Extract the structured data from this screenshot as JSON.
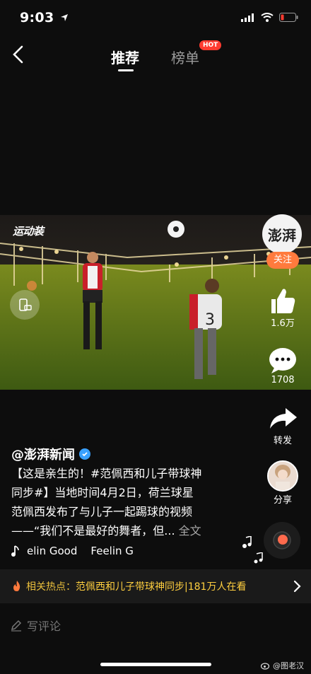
{
  "status": {
    "time": "9:03"
  },
  "nav": {
    "tabs": [
      "推荐",
      "榜单"
    ],
    "hot_badge": "HOT"
  },
  "video": {
    "watermark": "运动装"
  },
  "rail": {
    "avatar_text": "澎湃",
    "follow": "关注",
    "likes": "1.6万",
    "comments": "1708",
    "forward": "转发",
    "share": "分享"
  },
  "post": {
    "author": "@澎湃新闻",
    "caption_line1": "【这是亲生的！#范佩西和儿子带球神",
    "caption_line2": "同步#】当地时间4月2日，荷兰球星",
    "caption_line3": "范佩西发布了与儿子一起踢球的视频",
    "caption_line4": "——“我们不是最好的舞者，但...",
    "more": "全文",
    "music": "elin Good    Feelin G"
  },
  "hot_topic": {
    "label": "相关热点：",
    "text": "范佩西和儿子带球神同步|181万人在看"
  },
  "comment": {
    "placeholder": "写评论"
  },
  "weibo_watermark": "@图老汉",
  "colors": {
    "accent": "#ff7a3d",
    "hot": "#ffcf3f",
    "verified": "#3aa1ff",
    "hot_badge": "#ff3b30"
  },
  "icons": [
    "location-arrow-icon",
    "signal-icon",
    "wifi-icon",
    "battery-icon",
    "back-chevron-icon",
    "rotate-screen-icon",
    "thumb-up-icon",
    "comment-bubble-icon",
    "share-arrow-icon",
    "verified-icon",
    "music-note-icon",
    "flame-icon",
    "chevron-right-icon",
    "pencil-icon",
    "weibo-icon"
  ]
}
